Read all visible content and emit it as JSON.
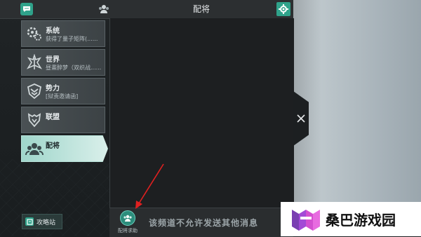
{
  "header": {
    "title": "配将"
  },
  "sidebar": {
    "items": [
      {
        "title": "系统",
        "subtitle": "获得了量子矩阵(......",
        "icon": "gear-cluster-icon"
      },
      {
        "title": "世界",
        "subtitle": "昼畫醉梦（双织战......",
        "icon": "world-icon"
      },
      {
        "title": "势力",
        "subtitle": "[狱责邀请函]",
        "icon": "faction-shield-icon"
      },
      {
        "title": "联盟",
        "subtitle": "",
        "icon": "alliance-icon"
      },
      {
        "title": "配将",
        "subtitle": "",
        "icon": "team-icon"
      }
    ],
    "strategy_label": "攻略站"
  },
  "bottom": {
    "help_label": "配将求助",
    "message": "该频道不允许发送其他消息"
  },
  "watermark": {
    "text": "桑巴游戏园"
  },
  "colors": {
    "accent": "#2fa28a",
    "active_item": "#c2e6de",
    "arrow": "#e02020"
  }
}
